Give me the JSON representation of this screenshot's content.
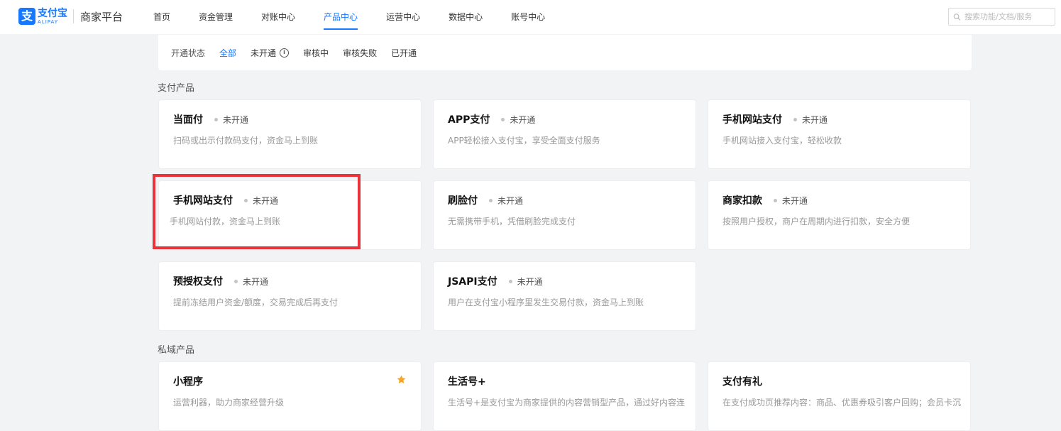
{
  "header": {
    "logo_cn": "支付宝",
    "logo_en": "ALIPAY",
    "platform": "商家平台",
    "nav": [
      {
        "label": "首页",
        "active": false
      },
      {
        "label": "资金管理",
        "active": false
      },
      {
        "label": "对账中心",
        "active": false
      },
      {
        "label": "产品中心",
        "active": true
      },
      {
        "label": "运营中心",
        "active": false
      },
      {
        "label": "数据中心",
        "active": false
      },
      {
        "label": "账号中心",
        "active": false
      }
    ],
    "search": {
      "placeholder": "搜索功能/文档/服务",
      "value": ""
    }
  },
  "filter": {
    "label": "开通状态",
    "items": [
      {
        "label": "全部",
        "active": true
      },
      {
        "label": "未开通",
        "active": false,
        "has_info": true
      },
      {
        "label": "审核中",
        "active": false
      },
      {
        "label": "审核失败",
        "active": false
      },
      {
        "label": "已开通",
        "active": false
      }
    ]
  },
  "sections": [
    {
      "title": "支付产品",
      "cards": [
        {
          "title": "当面付",
          "status": "未开通",
          "desc": "扫码或出示付款码支付，资金马上到账"
        },
        {
          "title": "APP支付",
          "status": "未开通",
          "desc": "APP轻松接入支付宝，享受全面支付服务"
        },
        {
          "title": "手机网站支付",
          "status": "未开通",
          "desc": "手机网站接入支付宝，轻松收款"
        },
        {
          "title": "手机网站支付",
          "status": "未开通",
          "desc": "手机网站付款，资金马上到账"
        },
        {
          "title": "刷脸付",
          "status": "未开通",
          "desc": "无需携带手机，凭借刷脸完成支付"
        },
        {
          "title": "商家扣款",
          "status": "未开通",
          "desc": "按照用户授权，商户在周期内进行扣款，安全方便"
        },
        {
          "title": "预授权支付",
          "status": "未开通",
          "desc": "提前冻结用户资金/额度，交易完成后再支付"
        },
        {
          "title": "JSAPI支付",
          "status": "未开通",
          "desc": "用户在支付宝小程序里发生交易付款，资金马上到账"
        }
      ]
    },
    {
      "title": "私域产品",
      "cards": [
        {
          "title": "小程序",
          "status": "",
          "desc": "运营利器，助力商家经营升级",
          "starred": true
        },
        {
          "title": "生活号+",
          "status": "",
          "desc": "生活号+是支付宝为商家提供的内容营销型产品，通过好内容连"
        },
        {
          "title": "支付有礼",
          "status": "",
          "desc": "在支付成功页推荐内容：商品、优惠券吸引客户回购；会员卡沉"
        }
      ]
    }
  ],
  "colors": {
    "accent": "#1677ff",
    "highlight": "#e8333a",
    "star": "#f5a623"
  }
}
